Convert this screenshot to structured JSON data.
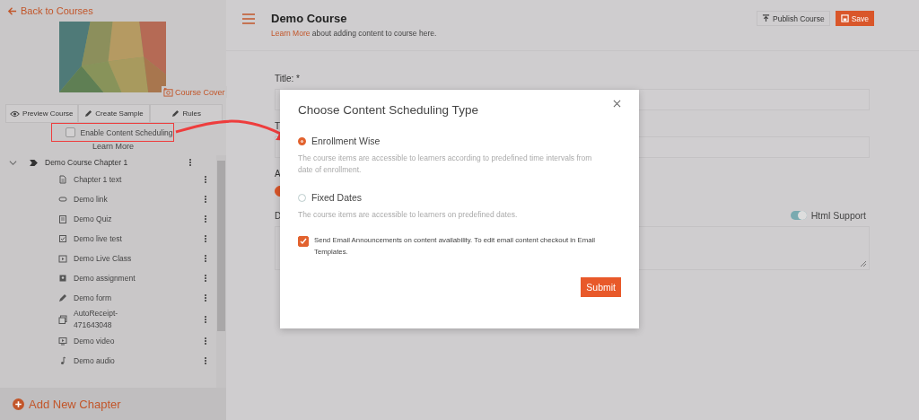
{
  "sidebar": {
    "back_link": "Back to Courses",
    "cover": {
      "kind": "picture",
      "button": "Course Cover"
    },
    "actions": [
      "Preview Course",
      "Create Sample",
      "Rules"
    ],
    "scheduling": {
      "label": "Enable Content Scheduling",
      "checked": false
    },
    "learn_more": "Learn More",
    "chapters": [
      {
        "title": "Demo Course Chapter 1",
        "expanded": true,
        "children": [
          {
            "title": "Chapter 1 text",
            "kind": "text"
          },
          {
            "title": "Demo link",
            "kind": "link"
          },
          {
            "title": "Demo Quiz",
            "kind": "quiz"
          },
          {
            "title": "Demo live test",
            "kind": "test"
          },
          {
            "title": "Demo Live Class",
            "kind": "live"
          },
          {
            "title": "Demo assignment",
            "kind": "assignment"
          },
          {
            "title": "Demo form",
            "kind": "form"
          },
          {
            "title": "AutoReceipt-471643048",
            "kind": "receipt"
          },
          {
            "title": "Demo video",
            "kind": "video"
          },
          {
            "title": "Demo audio",
            "kind": "audio"
          }
        ]
      }
    ],
    "add_chapter": "Add New Chapter"
  },
  "header": {
    "title": "Demo Course",
    "link": "Learn More",
    "note": "about adding content to course here.",
    "buttons": [
      {
        "label": "Publish Course",
        "primary": false
      },
      {
        "label": "Save",
        "primary": true
      }
    ]
  },
  "form": {
    "fields": [
      {
        "label": "Title: *",
        "kind": "input"
      },
      {
        "label": "T",
        "kind": "input"
      },
      {
        "label": "A",
        "kind": "radio",
        "selected": true
      },
      {
        "label": "D",
        "kind": "textarea"
      }
    ],
    "html_support": {
      "label": "Html Support",
      "on": true
    }
  },
  "modal": {
    "title": "Choose Content Scheduling Type",
    "options": [
      {
        "label": "Enrollment Wise",
        "description": "The course items are accessible to learners according to predefined time intervals from date of enrollment.",
        "selected": true
      },
      {
        "label": "Fixed Dates",
        "description": "The course items are accessible to learners on predefined dates.",
        "selected": false
      }
    ],
    "email": {
      "label": "Send Email Announcements on content availability. To edit email content checkout in Email Templates.",
      "checked": true
    },
    "submit": "Submit"
  }
}
